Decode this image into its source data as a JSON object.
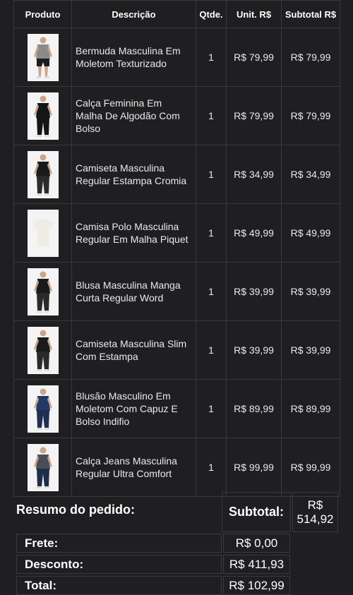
{
  "table": {
    "headers": {
      "product": "Produto",
      "description": "Descrição",
      "qty": "Qtde.",
      "unit": "Unit. R$",
      "subtotal": "Subtotal R$"
    },
    "rows": [
      {
        "image": "shorts-model-photo",
        "description": "Bermuda Masculina Em Moletom Texturizado",
        "qty": "1",
        "unit": "R$ 79,99",
        "subtotal": "R$ 79,99"
      },
      {
        "image": "pants-model-photo",
        "description": "Calça Feminina Em Malha De Algodão Com Bolso",
        "qty": "1",
        "unit": "R$ 79,99",
        "subtotal": "R$ 79,99"
      },
      {
        "image": "tshirt-model-photo",
        "description": "Camiseta Masculina Regular Estampa Cromia",
        "qty": "1",
        "unit": "R$ 34,99",
        "subtotal": "R$ 34,99"
      },
      {
        "image": "polo-shirt-photo",
        "description": "Camisa Polo Masculina Regular Em Malha Piquet",
        "qty": "1",
        "unit": "R$ 49,99",
        "subtotal": "R$ 49,99"
      },
      {
        "image": "tshirt-model-photo",
        "description": "Blusa Masculina Manga Curta Regular Word",
        "qty": "1",
        "unit": "R$ 39,99",
        "subtotal": "R$ 39,99"
      },
      {
        "image": "tshirt-model-photo",
        "description": "Camiseta Masculina Slim Com Estampa",
        "qty": "1",
        "unit": "R$ 39,99",
        "subtotal": "R$ 39,99"
      },
      {
        "image": "hoodie-model-photo",
        "description": "Blusão Masculino Em Moletom Com Capuz E Bolso Indifio",
        "qty": "1",
        "unit": "R$ 89,99",
        "subtotal": "R$ 89,99"
      },
      {
        "image": "jeans-model-photo",
        "description": "Calça Jeans Masculina Regular Ultra Comfort",
        "qty": "1",
        "unit": "R$ 99,99",
        "subtotal": "R$ 99,99"
      }
    ]
  },
  "summary": {
    "title": "Resumo do pedido:",
    "subtotal_label": "Subtotal:",
    "subtotal_value": "R$ 514,92",
    "shipping_label": "Frete:",
    "shipping_value": "R$ 0,00",
    "discount_label": "Desconto:",
    "discount_value": "R$ 411,93",
    "total_label": "Total:",
    "total_value": "R$ 102,99"
  },
  "colors": {
    "background": "#1f1f21",
    "border": "#3a3a3e",
    "text": "#f2f2f2"
  }
}
